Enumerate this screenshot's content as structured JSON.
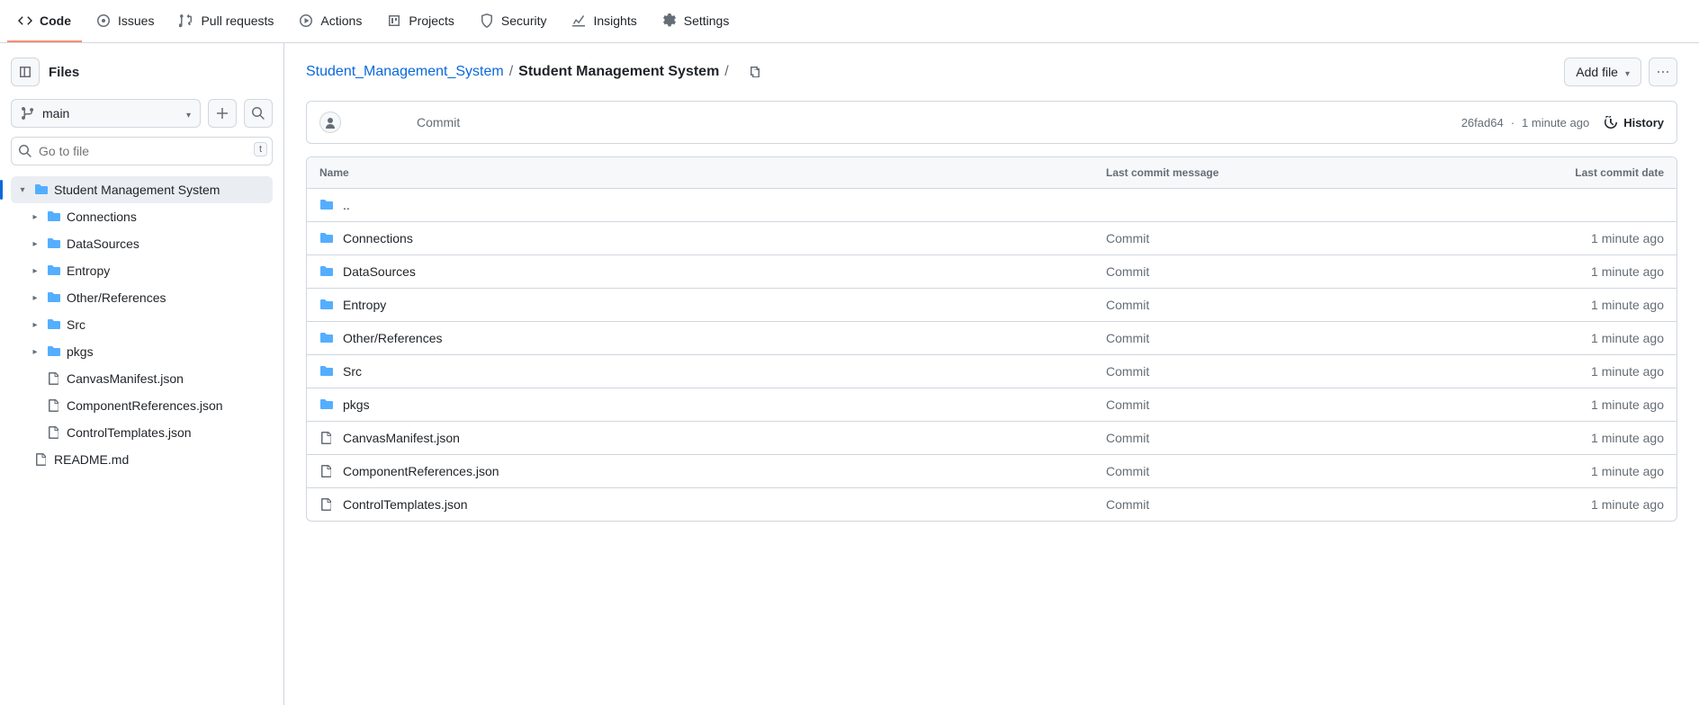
{
  "nav": {
    "items": [
      {
        "label": "Code",
        "icon": "code"
      },
      {
        "label": "Issues",
        "icon": "issue"
      },
      {
        "label": "Pull requests",
        "icon": "pr"
      },
      {
        "label": "Actions",
        "icon": "play"
      },
      {
        "label": "Projects",
        "icon": "project"
      },
      {
        "label": "Security",
        "icon": "shield"
      },
      {
        "label": "Insights",
        "icon": "graph"
      },
      {
        "label": "Settings",
        "icon": "gear"
      }
    ]
  },
  "sidebar": {
    "title": "Files",
    "branch": "main",
    "search_placeholder": "Go to file",
    "kbd": "t",
    "tree": [
      {
        "type": "folder",
        "name": "Student Management System",
        "depth": 0,
        "open": true,
        "selected": true
      },
      {
        "type": "folder",
        "name": "Connections",
        "depth": 1
      },
      {
        "type": "folder",
        "name": "DataSources",
        "depth": 1
      },
      {
        "type": "folder",
        "name": "Entropy",
        "depth": 1
      },
      {
        "type": "folder",
        "name": "Other/References",
        "depth": 1
      },
      {
        "type": "folder",
        "name": "Src",
        "depth": 1
      },
      {
        "type": "folder",
        "name": "pkgs",
        "depth": 1
      },
      {
        "type": "file",
        "name": "CanvasManifest.json",
        "depth": 1
      },
      {
        "type": "file",
        "name": "ComponentReferences.json",
        "depth": 1
      },
      {
        "type": "file",
        "name": "ControlTemplates.json",
        "depth": 1
      },
      {
        "type": "file",
        "name": "README.md",
        "depth": 0
      }
    ]
  },
  "breadcrumb": {
    "root": "Student_Management_System",
    "current": "Student Management System"
  },
  "actions": {
    "add_file": "Add file"
  },
  "commit": {
    "message": "Commit",
    "sha": "26fad64",
    "time": "1 minute ago",
    "history": "History"
  },
  "table": {
    "cols": {
      "name": "Name",
      "msg": "Last commit message",
      "date": "Last commit date"
    },
    "parent": "..",
    "rows": [
      {
        "type": "folder",
        "name": "Connections",
        "msg": "Commit",
        "date": "1 minute ago"
      },
      {
        "type": "folder",
        "name": "DataSources",
        "msg": "Commit",
        "date": "1 minute ago"
      },
      {
        "type": "folder",
        "name": "Entropy",
        "msg": "Commit",
        "date": "1 minute ago"
      },
      {
        "type": "folder",
        "name": "Other/References",
        "msg": "Commit",
        "date": "1 minute ago"
      },
      {
        "type": "folder",
        "name": "Src",
        "msg": "Commit",
        "date": "1 minute ago"
      },
      {
        "type": "folder",
        "name": "pkgs",
        "msg": "Commit",
        "date": "1 minute ago"
      },
      {
        "type": "file",
        "name": "CanvasManifest.json",
        "msg": "Commit",
        "date": "1 minute ago"
      },
      {
        "type": "file",
        "name": "ComponentReferences.json",
        "msg": "Commit",
        "date": "1 minute ago"
      },
      {
        "type": "file",
        "name": "ControlTemplates.json",
        "msg": "Commit",
        "date": "1 minute ago"
      }
    ]
  }
}
